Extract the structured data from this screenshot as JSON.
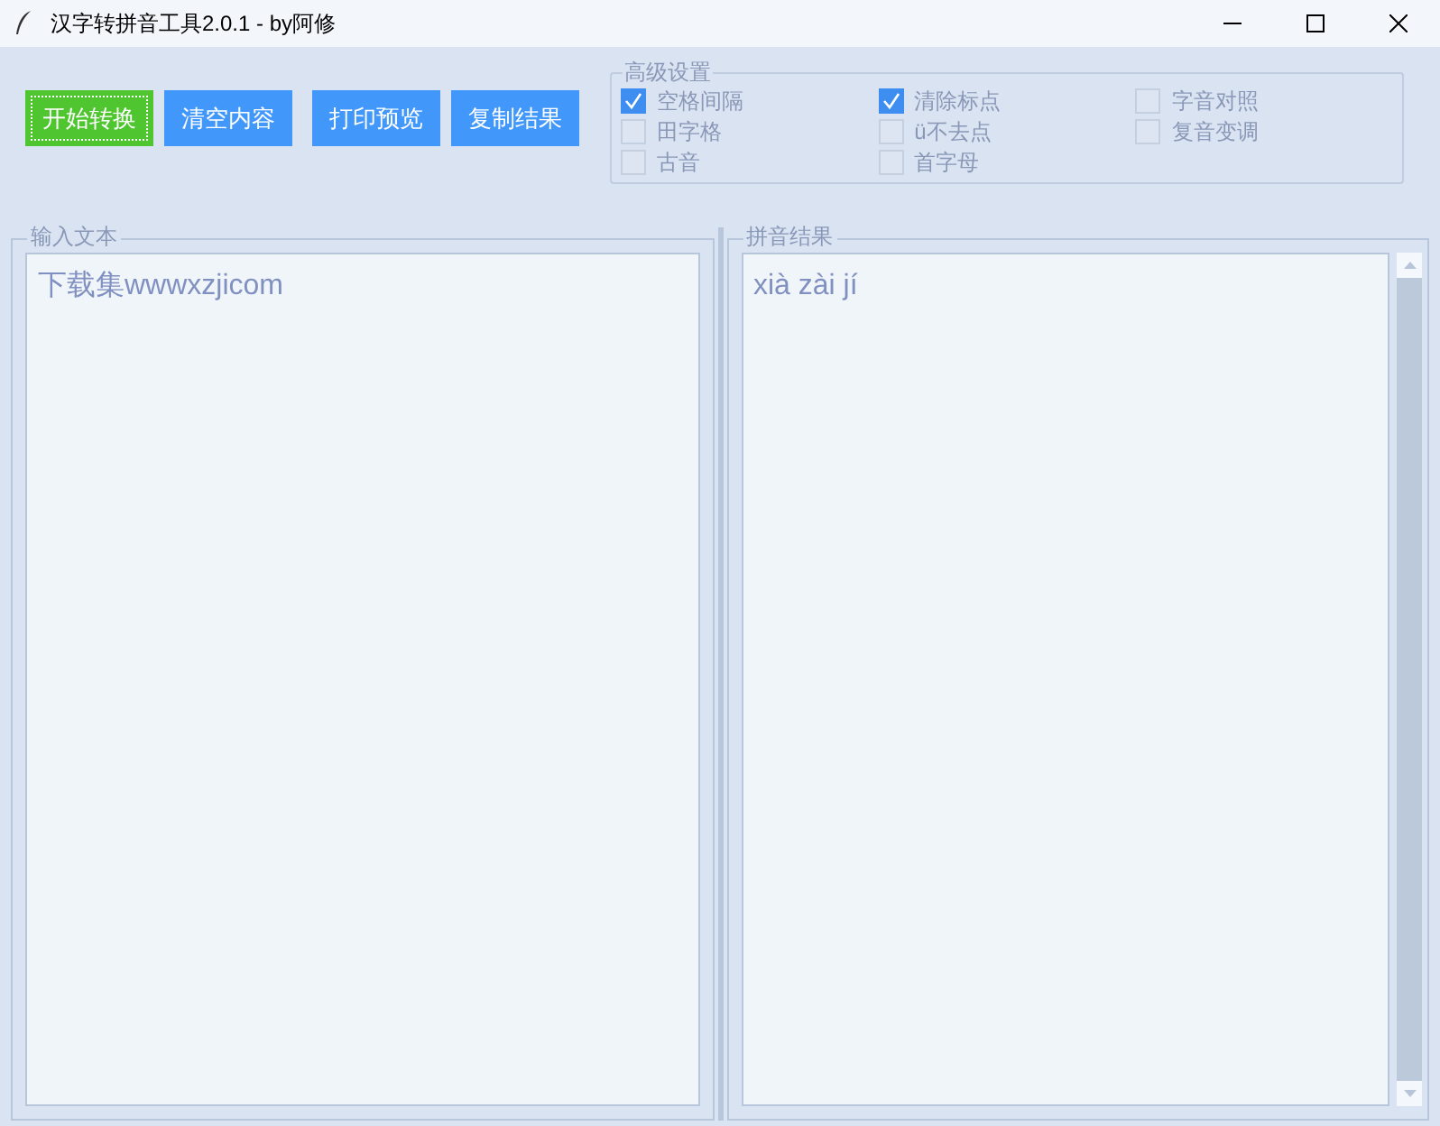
{
  "window": {
    "title": "汉字转拼音工具2.0.1 - by阿修"
  },
  "buttons": [
    {
      "label": "开始转换",
      "kind": "primary",
      "focused": true
    },
    {
      "label": "清空内容",
      "kind": "normal",
      "focused": false
    },
    {
      "label": "打印预览",
      "kind": "normal",
      "focused": false
    },
    {
      "label": "复制结果",
      "kind": "normal",
      "focused": false
    }
  ],
  "advanced": {
    "title": "高级设置",
    "options": [
      {
        "label": "空格间隔",
        "checked": true
      },
      {
        "label": "田字格",
        "checked": false
      },
      {
        "label": "古音",
        "checked": false
      },
      {
        "label": "清除标点",
        "checked": true
      },
      {
        "label": "ü不去点",
        "checked": false
      },
      {
        "label": "首字母",
        "checked": false
      },
      {
        "label": "字音对照",
        "checked": false
      },
      {
        "label": "复音变调",
        "checked": false
      }
    ]
  },
  "input": {
    "title": "输入文本",
    "value": "下载集wwwxzjicom"
  },
  "result": {
    "title": "拼音结果",
    "value": "xià zài jí"
  }
}
